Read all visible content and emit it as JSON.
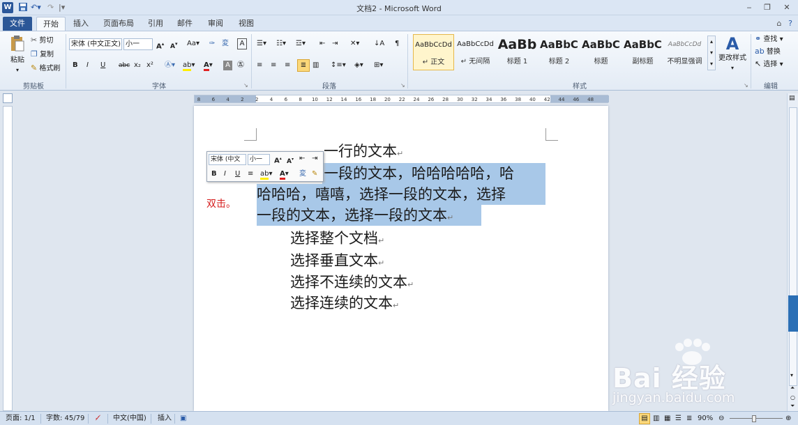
{
  "window": {
    "title": "文档2 - Microsoft Word",
    "app_icon": "W",
    "controls": [
      "‒",
      "❐",
      "✕"
    ]
  },
  "quick_access": [
    "save-icon",
    "undo-icon",
    "redo-icon"
  ],
  "tabs": [
    {
      "label": "文件"
    },
    {
      "label": "开始"
    },
    {
      "label": "插入"
    },
    {
      "label": "页面布局"
    },
    {
      "label": "引用"
    },
    {
      "label": "邮件"
    },
    {
      "label": "审阅"
    },
    {
      "label": "视图"
    }
  ],
  "ribbon": {
    "clipboard": {
      "paste": "粘贴",
      "cut": "剪切",
      "copy": "复制",
      "format_painter": "格式刷",
      "label": "剪贴板"
    },
    "font": {
      "family": "宋体 (中文正文)",
      "size": "小一",
      "format_buttons": [
        "B",
        "I",
        "U",
        "abc",
        "x₂",
        "x²"
      ],
      "label": "字体"
    },
    "paragraph": {
      "label": "段落"
    },
    "styles": {
      "items": [
        {
          "sample": "AaBbCcDd",
          "name": "↵ 正文"
        },
        {
          "sample": "AaBbCcDd",
          "name": "↵ 无间隔"
        },
        {
          "sample": "AaBb",
          "name": "标题 1"
        },
        {
          "sample": "AaBbC",
          "name": "标题 2"
        },
        {
          "sample": "AaBbC",
          "name": "标题"
        },
        {
          "sample": "AaBbC",
          "name": "副标题"
        },
        {
          "sample": "AaBbCcDd",
          "name": "不明显强调"
        }
      ],
      "change_styles": "更改样式",
      "label": "样式"
    },
    "editing": {
      "find": "查找",
      "replace": "替换",
      "select": "选择",
      "label": "编辑"
    }
  },
  "ruler": {
    "ticks": [
      "8",
      "6",
      "4",
      "2",
      "2",
      "4",
      "6",
      "8",
      "10",
      "12",
      "14",
      "16",
      "18",
      "20",
      "22",
      "24",
      "26",
      "28",
      "30",
      "32",
      "34",
      "36",
      "38",
      "40",
      "42",
      "44",
      "46",
      "48"
    ]
  },
  "document": {
    "lines": [
      "选择一行的文本",
      "选择一段的文本，哈哈哈哈哈，哈",
      "哈哈哈，嘻嘻，选择一段的文本，选择",
      "一段的文本，选择一段的文本",
      "选择整个文档",
      "选择垂直文本",
      "选择不连续的文本",
      "选择连续的文本"
    ],
    "line1_visible": "一行的文本",
    "line2_visible": "一段的文本，哈哈哈哈哈，哈",
    "annotation": "双击。"
  },
  "minitoolbar": {
    "font": "宋体 (中文",
    "size": "小一"
  },
  "status": {
    "page": "页面: 1/1",
    "words": "字数: 45/79",
    "language": "中文(中国)",
    "mode": "插入",
    "zoom": "90%"
  },
  "watermark": {
    "brand": "Bai 经验",
    "url": "jingyan.baidu.com"
  }
}
